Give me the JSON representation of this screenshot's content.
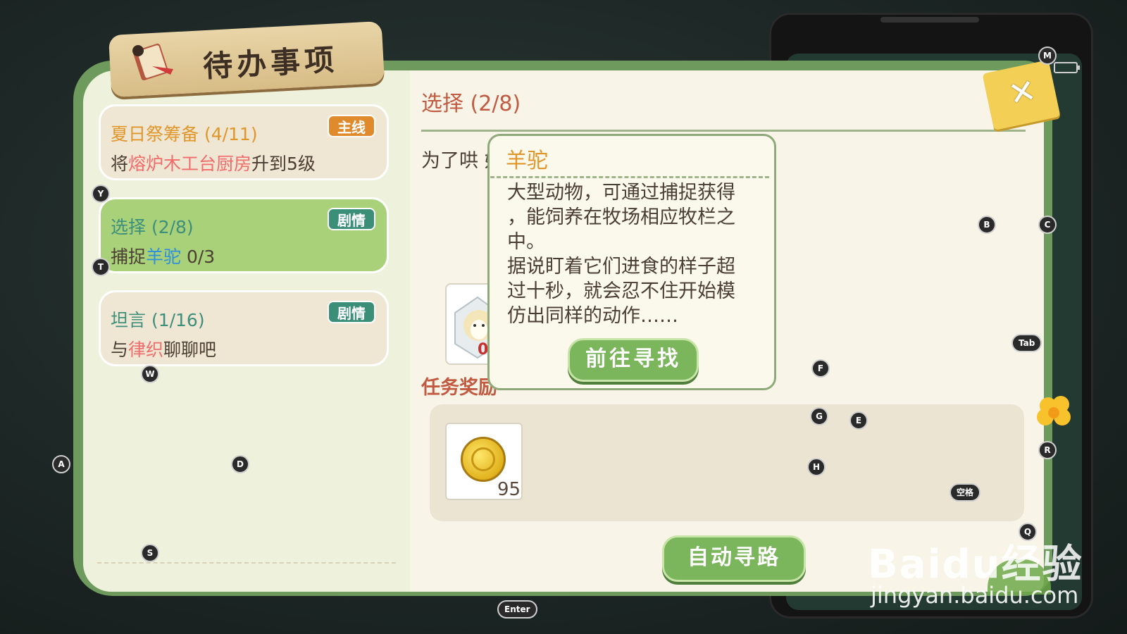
{
  "header": {
    "title": "待办事项",
    "book_icon": "book-icon"
  },
  "tasks": [
    {
      "title": "夏日祭筹备 (4/11)",
      "tag": "主线",
      "desc_parts": [
        "将",
        "熔炉木工台厨房",
        "升到5级"
      ]
    },
    {
      "title": "选择 (2/8)",
      "tag": "剧情",
      "desc_parts": [
        "捕捉",
        "羊驼",
        " 0/3"
      ]
    },
    {
      "title": "坦言 (1/16)",
      "tag": "剧情",
      "desc_parts": [
        "与",
        "律织",
        "聊聊吧"
      ]
    }
  ],
  "detail": {
    "title": "选择 (2/8)",
    "description": "为了哄                                                    她最喜欢的动物吧。",
    "task_item_badge": "0",
    "reward_label": "任务奖励",
    "reward_coin_count": "95",
    "auto_path_button": "自动寻路"
  },
  "popup": {
    "title": "羊驼",
    "body_lines": [
      "大型动物，可通过捕捉获得",
      "，能饲养在牧场相应牧栏之",
      "中。",
      "据说盯着它们进食的样子超",
      "过十秒，就会忍不住开始模",
      "仿出同样的动作……"
    ],
    "goto_button": "前往寻找"
  },
  "close_icon": "close-icon",
  "key_hints": [
    "M",
    "Y",
    "T",
    "W",
    "A",
    "D",
    "S",
    "B",
    "C",
    "Tab",
    "F",
    "G",
    "E",
    "H",
    "R",
    "空格",
    "Q",
    "Enter"
  ],
  "watermark": {
    "brand": "Baidu经验",
    "url": "jingyan.baidu.com"
  },
  "colors": {
    "panel_green": "#6f9a5e",
    "selected_card": "#a9d17a",
    "accent_orange": "#e0962b",
    "accent_teal": "#3d8f7c",
    "title_red": "#c25a42"
  }
}
